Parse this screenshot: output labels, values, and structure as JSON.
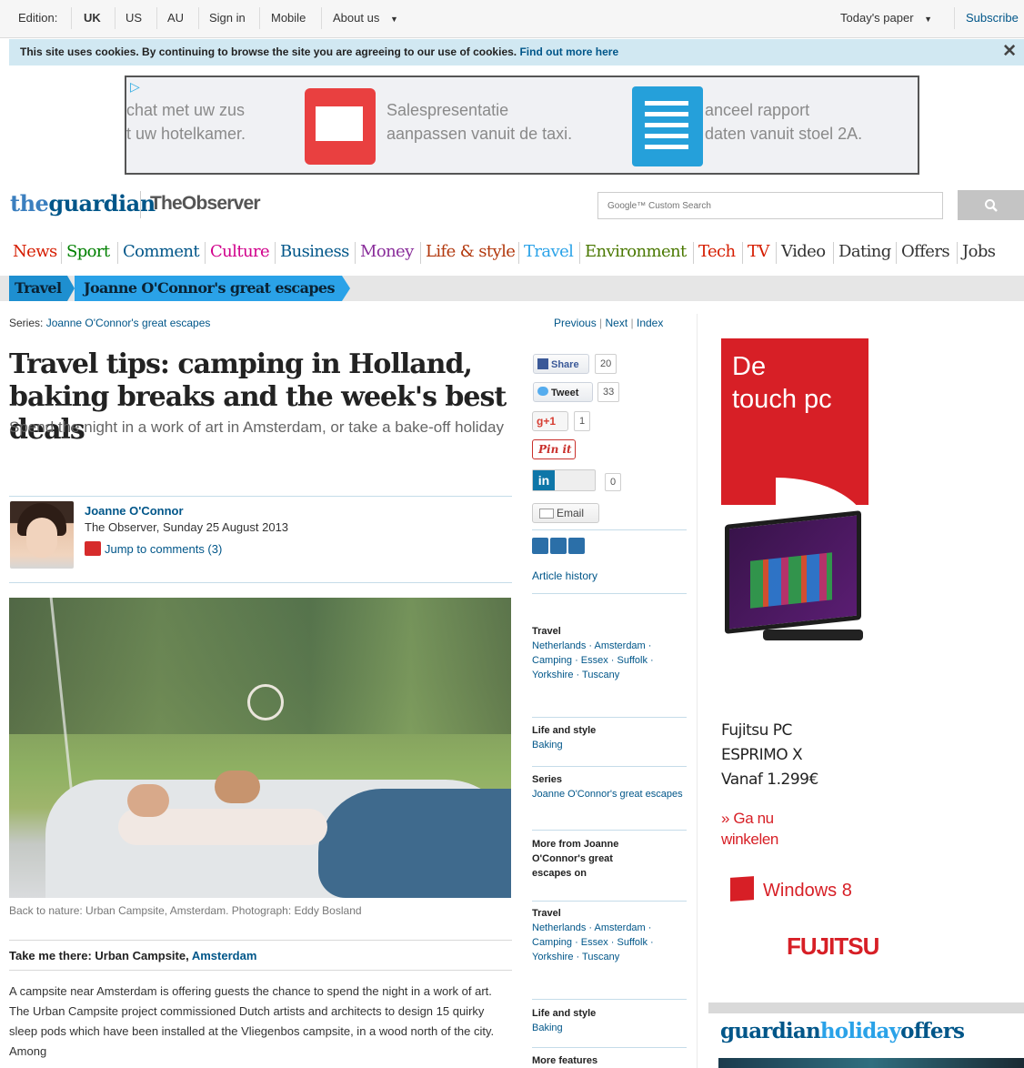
{
  "topbar": {
    "edition_label": "Edition:",
    "editions": [
      "UK",
      "US",
      "AU"
    ],
    "signin": "Sign in",
    "mobile": "Mobile",
    "about": "About us",
    "todays_paper": "Today's paper",
    "subscribe": "Subscribe"
  },
  "cookie": {
    "text": "This site uses cookies. By continuing to browse the site you are agreeing to our use of cookies.",
    "link": "Find out more here",
    "close": "✕"
  },
  "banner": {
    "adchoices": "▷",
    "text1a": "chat met uw zus",
    "text1b": "t uw hotelkamer.",
    "text2a": "Salespresentatie",
    "text2b": "aanpassen vanuit de taxi.",
    "text3a": "anceel rapport",
    "text3b": "daten vanuit stoel 2A."
  },
  "masthead": {
    "logo_the": "the",
    "logo_guardian": "guardian",
    "observer": "TheObserver",
    "search_placeholder": "Google™ Custom Search"
  },
  "nav": [
    "News",
    "Sport",
    "Comment",
    "Culture",
    "Business",
    "Money",
    "Life & style",
    "Travel",
    "Environment",
    "Tech",
    "TV",
    "Video",
    "Dating",
    "Offers",
    "Jobs"
  ],
  "nav_colors": [
    "#d61d00",
    "#008000",
    "#005689",
    "#d1008b",
    "#005689",
    "#8a2e9b",
    "#b2380d",
    "#2aa2e8",
    "#4a7801",
    "#d61d00",
    "#d61d00",
    "#333333",
    "#333333",
    "#333333",
    "#333333"
  ],
  "breadcrumb": {
    "section": "Travel",
    "series": "Joanne O'Connor's great escapes"
  },
  "series_line": {
    "label": "Series:",
    "name": "Joanne O'Connor's great escapes",
    "previous": "Previous",
    "next": "Next",
    "index": "Index"
  },
  "article": {
    "headline": "Travel tips: camping in Holland, baking breaks and the week's best deals",
    "standfirst": "Spend the night in a work of art in Amsterdam, or take a bake-off holiday",
    "author": "Joanne O'Connor",
    "date": "The Observer, Sunday 25 August 2013",
    "comments": "Jump to comments (3)",
    "caption": "Back to nature: Urban Campsite, Amsterdam. Photograph: Eddy Bosland",
    "take_me_there": "Take me there: Urban Campsite,",
    "take_me_there_link": "Amsterdam",
    "body": "A campsite near Amsterdam is offering guests the chance to spend the night in a work of art. The Urban Campsite project commissioned Dutch artists and architects to design 15 quirky sleep pods which have been installed at the Vliegenbos campsite, in a wood north of the city. Among"
  },
  "share": {
    "facebook": "Share",
    "facebook_count": "20",
    "twitter": "Tweet",
    "twitter_count": "33",
    "gplus": "+1",
    "gplus_count": "1",
    "pinterest": "Pin it",
    "linkedin_count": "0",
    "email": "Email",
    "history": "Article history"
  },
  "tags": {
    "travel1_head": "Travel",
    "travel1_body": "Netherlands · Amsterdam · Camping · Essex · Suffolk · Yorkshire · Tuscany",
    "life1_head": "Life and style",
    "life1_body": "Baking",
    "series_head": "Series",
    "series_body": "Joanne O'Connor's great escapes",
    "more_from": "More from Joanne O'Connor's great escapes on",
    "travel2_head": "Travel",
    "travel2_body": "Netherlands · Amsterdam · Camping · Essex · Suffolk · Yorkshire · Tuscany",
    "life2_head": "Life and style",
    "life2_body": "Baking",
    "more_features": "More features"
  },
  "right_ad": {
    "headline_1": "De",
    "headline_2": "touch pc",
    "product_1": "Fujitsu PC",
    "product_2": "ESPRIMO X",
    "product_3": "Vanaf 1.299€",
    "cta_1": "» Ga nu",
    "cta_2": "winkelen",
    "windows": "Windows 8",
    "fujitsu": "FUJITSU"
  },
  "holiday": {
    "part1": "guardian",
    "part2": "holiday",
    "part3": "offers"
  }
}
